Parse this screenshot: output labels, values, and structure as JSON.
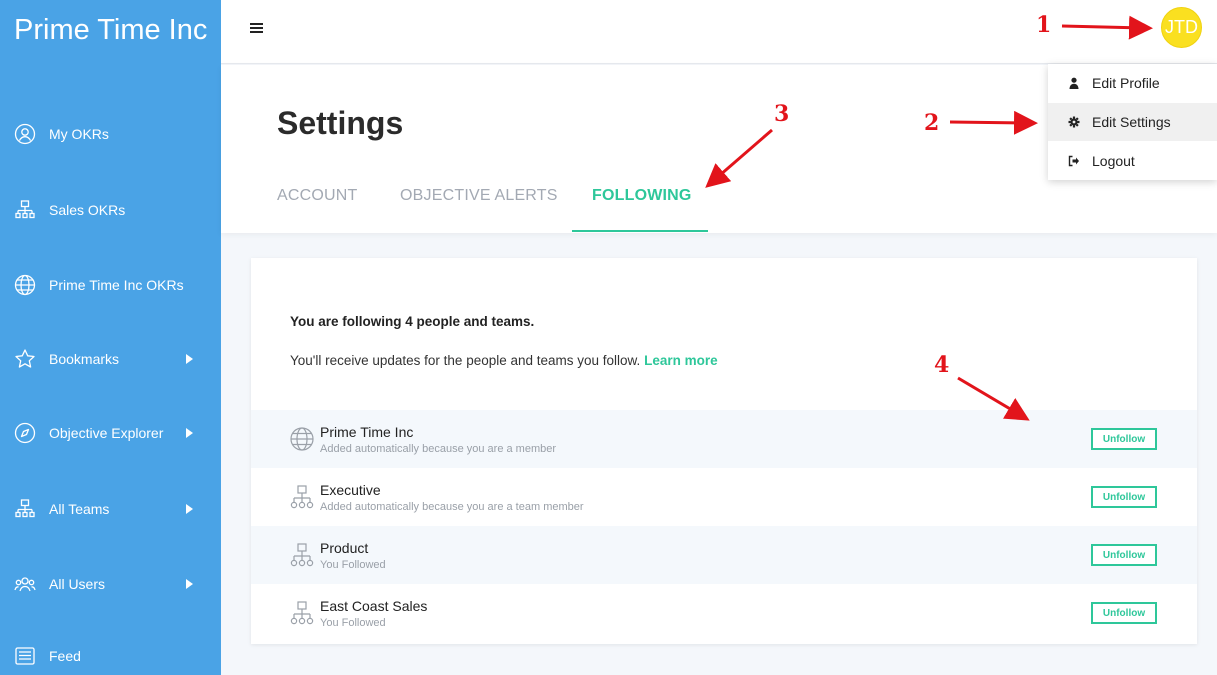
{
  "app": {
    "brand": "Prime Time Inc"
  },
  "sidebar": {
    "items": [
      {
        "label": "My OKRs",
        "icon": "user-circle-icon",
        "has_submenu": false
      },
      {
        "label": "Sales OKRs",
        "icon": "org-chart-icon",
        "has_submenu": false
      },
      {
        "label": "Prime Time Inc OKRs",
        "icon": "globe-icon",
        "has_submenu": false
      },
      {
        "label": "Bookmarks",
        "icon": "star-icon",
        "has_submenu": true
      },
      {
        "label": "Objective Explorer",
        "icon": "compass-icon",
        "has_submenu": true
      },
      {
        "label": "All Teams",
        "icon": "org-chart-icon",
        "has_submenu": true
      },
      {
        "label": "All Users",
        "icon": "users-icon",
        "has_submenu": true
      },
      {
        "label": "Feed",
        "icon": "feed-icon",
        "has_submenu": false
      }
    ]
  },
  "topbar": {
    "menu_icon": "hamburger-icon",
    "avatar_initials": "JTD",
    "avatar_color": "#fae020"
  },
  "user_menu": {
    "items": [
      {
        "label": "Edit Profile",
        "icon": "person-icon"
      },
      {
        "label": "Edit Settings",
        "icon": "gear-icon",
        "highlighted": true
      },
      {
        "label": "Logout",
        "icon": "logout-icon"
      }
    ]
  },
  "settings": {
    "title": "Settings",
    "tabs": [
      {
        "label": "ACCOUNT",
        "active": false
      },
      {
        "label": "OBJECTIVE ALERTS",
        "active": false
      },
      {
        "label": "FOLLOWING",
        "active": true
      }
    ],
    "following": {
      "summary": "You are following 4 people and teams.",
      "info": "You'll receive updates for the people and teams you follow.",
      "learn_more": "Learn more",
      "rows": [
        {
          "name": "Prime Time Inc",
          "reason": "Added automatically because you are a member",
          "icon": "globe-icon",
          "action": "Unfollow"
        },
        {
          "name": "Executive",
          "reason": "Added automatically because you are a team member",
          "icon": "org-chart-icon",
          "action": "Unfollow"
        },
        {
          "name": "Product",
          "reason": "You Followed",
          "icon": "org-chart-icon",
          "action": "Unfollow"
        },
        {
          "name": "East Coast Sales",
          "reason": "You Followed",
          "icon": "org-chart-icon",
          "action": "Unfollow"
        }
      ]
    }
  },
  "annotations": {
    "step1": "1",
    "step2": "2",
    "step3": "3",
    "step4": "4"
  },
  "colors": {
    "sidebar": "#4aa3e6",
    "accent": "#2ec79a",
    "annotation": "#e2141b"
  }
}
